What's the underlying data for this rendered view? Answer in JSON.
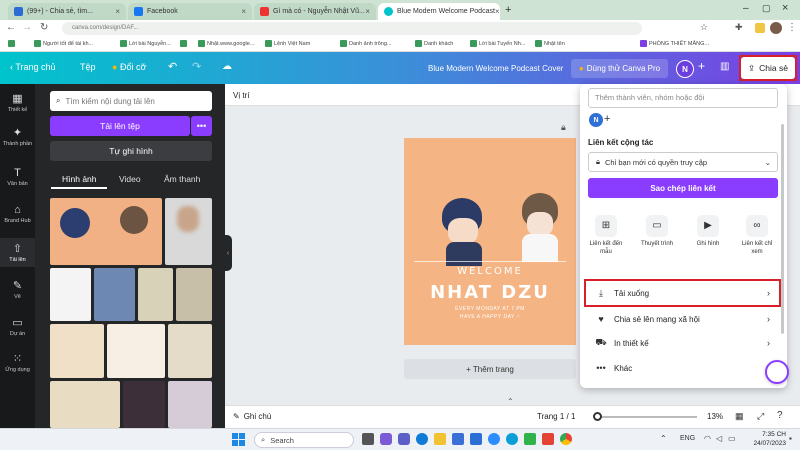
{
  "browser": {
    "tabs": [
      {
        "label": "(99+) - Chia sẻ, tìm...",
        "active": false
      },
      {
        "label": "Facebook",
        "active": false
      },
      {
        "label": "Gì mà có - Nguyễn Nhật Vũ...",
        "active": false
      },
      {
        "label": "Blue Modern Welcome Podcast",
        "active": true
      }
    ],
    "url": "canva.com/design/DAF...",
    "bookmarks": [
      "",
      "Người tốt để tài kh...",
      "Lời bài Nguyễn...",
      "",
      "Nhật.www.google...",
      "Lệnh Việt Nam",
      "Danh ảnh trông...",
      "Danh khách",
      "Lời bài Tuyển Nh...",
      "Nhật tên",
      "PHÒNG THIẾT MĂNG..."
    ]
  },
  "header": {
    "home": "Trang chủ",
    "file": "Tệp",
    "resize": "Đổi cỡ",
    "title": "Blue Modern Welcome Podcast Cover",
    "try_pro": "Dùng thử Canva Pro",
    "avatar": "N",
    "share": "Chia sẻ"
  },
  "rail": [
    {
      "label": "Thiết kế",
      "icon": "layout-icon"
    },
    {
      "label": "Thành phần",
      "icon": "elements-icon"
    },
    {
      "label": "Văn bản",
      "icon": "text-icon"
    },
    {
      "label": "Brand Hub",
      "icon": "brand-icon"
    },
    {
      "label": "Tải lên",
      "icon": "upload-icon"
    },
    {
      "label": "Vẽ",
      "icon": "draw-icon"
    },
    {
      "label": "Dự án",
      "icon": "folder-icon"
    },
    {
      "label": "Ứng dụng",
      "icon": "apps-icon"
    }
  ],
  "panel": {
    "search_placeholder": "Tìm kiếm nội dung tải lên",
    "upload": "Tải lên tệp",
    "more": "•••",
    "record": "Tự ghi hình",
    "tabs": [
      "Hình ảnh",
      "Video",
      "Âm thanh"
    ]
  },
  "workspace": {
    "position": "Vị trí",
    "welcome": "WELCOME",
    "name": "NHAT DZU",
    "line1": "EVERY MONDAY AT 7 PM",
    "line2": "HAVE A HAPPY DAY ~",
    "add_page": "+ Thêm trang"
  },
  "bottombar": {
    "notes": "Ghi chú",
    "page": "Trang 1 / 1",
    "zoom": "13%"
  },
  "share": {
    "invite_placeholder": "Thêm thành viên, nhóm hoặc đội",
    "avatar": "N",
    "collab_label": "Liên kết cộng tác",
    "access": "Chỉ bạn mới có quyền truy cập",
    "copy_link": "Sao chép liên kết",
    "options": [
      {
        "label": "Liên kết đến mẫu",
        "icon": "template-icon"
      },
      {
        "label": "Thuyết trình",
        "icon": "present-icon"
      },
      {
        "label": "Ghi hình",
        "icon": "record-icon"
      },
      {
        "label": "Liên kết chỉ xem",
        "icon": "link-icon"
      }
    ],
    "rows": [
      {
        "label": "Tải xuống",
        "icon": "download-icon"
      },
      {
        "label": "Chia sẻ lên mạng xã hội",
        "icon": "social-icon"
      },
      {
        "label": "In thiết kế",
        "icon": "print-icon"
      },
      {
        "label": "Khác",
        "icon": "more-icon"
      }
    ]
  },
  "taskbar": {
    "search": "Search",
    "lang": "ENG",
    "time": "7:35 CH",
    "date": "24/07/2023"
  },
  "colors": {
    "accent": "#8b3dff",
    "highlight": "#d6202a",
    "design_bg": "#f4b483"
  }
}
